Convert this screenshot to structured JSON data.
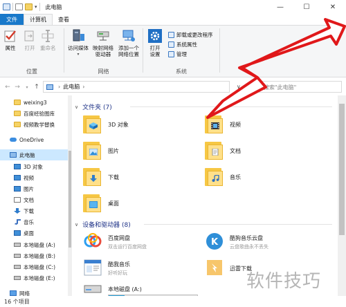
{
  "window": {
    "title": "此电脑",
    "minimize": "—",
    "maximize": "☐",
    "close": "✕"
  },
  "ribbon_tabs": [
    {
      "label": "文件"
    },
    {
      "label": "计算机"
    },
    {
      "label": "查看"
    }
  ],
  "ribbon": {
    "location": {
      "title": "位置",
      "buttons": [
        {
          "label": "属性"
        },
        {
          "label": "打开"
        },
        {
          "label": "重命名"
        }
      ]
    },
    "network": {
      "title": "网络",
      "buttons": [
        {
          "label": "访问媒体"
        },
        {
          "label": "映射网络\n驱动器"
        },
        {
          "label": "添加一个\n网络位置"
        }
      ]
    },
    "system": {
      "title": "系统",
      "buttons": [
        {
          "label": "打开\n设置"
        }
      ],
      "small": [
        {
          "label": "卸载或更改程序"
        },
        {
          "label": "系统属性"
        },
        {
          "label": "管理"
        }
      ]
    }
  },
  "addressbar": {
    "back": "←",
    "forward": "→",
    "up": "↑",
    "crumb": "此电脑",
    "separator": "›",
    "dropdown": "∨",
    "refresh": "↻",
    "search_placeholder": "搜索\"此电脑\""
  },
  "nav_pane": {
    "items": [
      {
        "label": "weixing3",
        "icon": "folder-icon"
      },
      {
        "label": "百度经验图库",
        "icon": "folder-icon"
      },
      {
        "label": "视频教学替换",
        "icon": "folder-icon"
      },
      {
        "label": "OneDrive",
        "icon": "onedrive-icon"
      },
      {
        "label": "此电脑",
        "icon": "pc-icon"
      },
      {
        "label": "3D 对象",
        "icon": "3d-objects-icon"
      },
      {
        "label": "视频",
        "icon": "video-icon"
      },
      {
        "label": "图片",
        "icon": "pictures-icon"
      },
      {
        "label": "文档",
        "icon": "documents-icon"
      },
      {
        "label": "下载",
        "icon": "downloads-icon"
      },
      {
        "label": "音乐",
        "icon": "music-icon"
      },
      {
        "label": "桌面",
        "icon": "desktop-icon"
      },
      {
        "label": "本地磁盘 (A:)",
        "icon": "drive-icon"
      },
      {
        "label": "本地磁盘 (B:)",
        "icon": "drive-icon"
      },
      {
        "label": "本地磁盘 (C:)",
        "icon": "drive-icon"
      },
      {
        "label": "本地磁盘 (E:)",
        "icon": "drive-icon"
      },
      {
        "label": "网络",
        "icon": "network-icon"
      }
    ]
  },
  "content": {
    "folders_header": "文件夹 (7)",
    "folders": [
      {
        "label": "3D 对象",
        "glyph": "3d"
      },
      {
        "label": "视频",
        "glyph": "video"
      },
      {
        "label": "图片",
        "glyph": "pictures"
      },
      {
        "label": "文档",
        "glyph": "documents"
      },
      {
        "label": "下载",
        "glyph": "downloads"
      },
      {
        "label": "音乐",
        "glyph": "music"
      },
      {
        "label": "桌面",
        "glyph": "desktop"
      }
    ],
    "devices_header": "设备和驱动器 (8)",
    "devices": [
      {
        "label": "百度网盘",
        "sub": "双击运行百度网盘",
        "icon": "baidu-netdisk-icon"
      },
      {
        "label": "酷狗音乐云盘",
        "sub": "云盘歌曲永不丢失",
        "icon": "kugou-cloud-icon"
      },
      {
        "label": "酷我音乐",
        "sub": "好听好玩",
        "icon": "kuwo-music-icon"
      },
      {
        "label": "迅雷下载",
        "sub": "",
        "icon": "xunlei-icon"
      },
      {
        "label": "本地磁盘 (A:)",
        "sub": "",
        "icon": "local-disk-icon",
        "usage": 0.18
      }
    ],
    "chevron": "∨"
  },
  "statusbar": {
    "text": "16 个项目"
  },
  "watermark": "软件技巧",
  "colors": {
    "file_tab": "#1979ca",
    "selection": "#cce8ff",
    "section_heading": "#1e3287",
    "folder": "#f6d365",
    "arrow_fill": "#ffffff",
    "arrow_stroke": "#e0181a"
  }
}
